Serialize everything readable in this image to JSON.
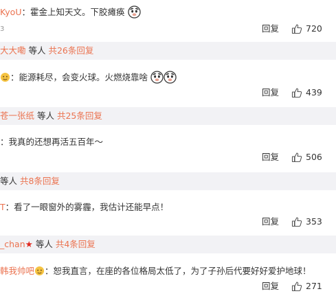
{
  "comments": [
    {
      "user": "KyoU",
      "sep": "：",
      "text": "霍金上知天文。下胶瘫痪",
      "emoji": "doge-icon",
      "timestamp": "3",
      "reply_label": "回复",
      "likes": "720",
      "sub": {
        "user": "大大嘞",
        "others": " 等人 ",
        "count": "共26条回复"
      }
    },
    {
      "user": "",
      "sep": "：",
      "text": "能源耗尽，会变火球。火燃烧靠啥",
      "emoji": "doge-icon",
      "timestamp": "",
      "reply_label": "回复",
      "likes": "439",
      "sub": {
        "user": "苍一张纸",
        "others": " 等人 ",
        "count": "共25条回复"
      }
    },
    {
      "user": "",
      "sep": "：",
      "text": "我真的还想再活五百年～",
      "emoji": "",
      "timestamp": "",
      "reply_label": "回复",
      "likes": "506",
      "sub": {
        "user": "",
        "others": " 等人 ",
        "count": "共8条回复"
      }
    },
    {
      "user": "T",
      "sep": "：",
      "text": "看了一眼窗外的雾霾，我估计还能早点！",
      "emoji": "",
      "timestamp": "",
      "reply_label": "回复",
      "likes": "353",
      "sub": {
        "user": "_chan",
        "others": " 等人 ",
        "count": "共4条回复"
      }
    },
    {
      "user": "韩我帅吧",
      "sep": "：",
      "text": "恕我直言，在座的各位格局太低了，为了子孙后代要好好爱护地球！",
      "emoji": "",
      "timestamp": "",
      "reply_label": "回复",
      "likes": "271"
    }
  ],
  "colors": {
    "username": "#eb7350",
    "sub_bg": "#f2f2f5",
    "text": "#333333",
    "star": "#e0281e"
  },
  "icons": {
    "like": "thumbs-up-icon",
    "doge": "doge-icon",
    "star": "star-icon",
    "avatar": "avatar-emoji-icon"
  }
}
